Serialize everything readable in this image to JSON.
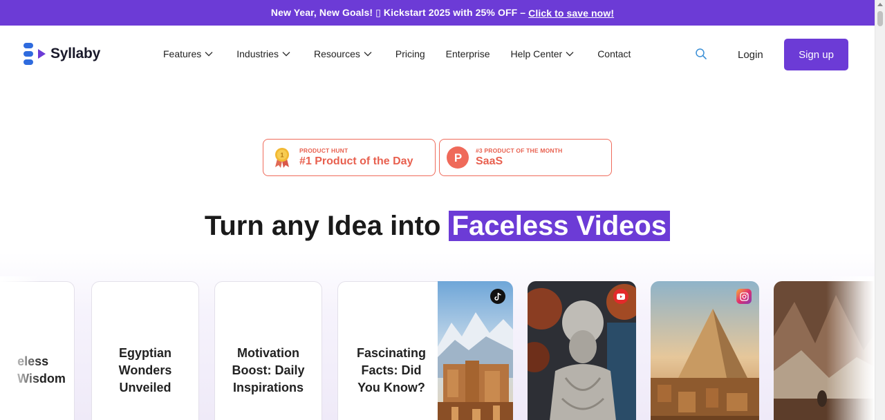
{
  "promo": {
    "text": "New Year, New Goals! ▯ Kickstart 2025 with 25% OFF –",
    "link": "Click to save now!"
  },
  "logo": {
    "text": "Syllaby"
  },
  "nav": {
    "items": [
      {
        "label": "Features",
        "dropdown": true
      },
      {
        "label": "Industries",
        "dropdown": true
      },
      {
        "label": "Resources",
        "dropdown": true
      },
      {
        "label": "Pricing",
        "dropdown": false
      },
      {
        "label": "Enterprise",
        "dropdown": false
      },
      {
        "label": "Help Center",
        "dropdown": true
      },
      {
        "label": "Contact",
        "dropdown": false
      }
    ],
    "search_icon": "search-icon",
    "login": "Login",
    "signup": "Sign up"
  },
  "badges": [
    {
      "kicker": "PRODUCT HUNT",
      "title": "#1 Product of the Day",
      "icon": "medal-icon",
      "medal_number": "1"
    },
    {
      "kicker": "#3 PRODUCT OF THE MONTH",
      "title": "SaaS",
      "icon": "product-hunt-icon",
      "letter": "P"
    }
  ],
  "hero": {
    "title_plain": "Turn any Idea into",
    "title_highlight": "Faceless Videos"
  },
  "gallery": {
    "text_cards": [
      {
        "lines": [
          "eless",
          "Wisdom"
        ]
      },
      {
        "lines": [
          "Egyptian",
          "Wonders",
          "Unveiled"
        ]
      },
      {
        "lines": [
          "Motivation",
          "Boost: Daily",
          "Inspirations"
        ]
      },
      {
        "lines": [
          "Fascinating",
          "Facts: Did",
          "You Know?"
        ]
      }
    ],
    "image_cards": [
      {
        "subject": "ancient-city-painting",
        "platform": "tiktok-icon"
      },
      {
        "subject": "philosopher-statue",
        "platform": "youtube-icon"
      },
      {
        "subject": "pyramid-landscape",
        "platform": "instagram-icon"
      },
      {
        "subject": "mountain-traveler",
        "platform": ""
      }
    ]
  },
  "colors": {
    "brand": "#6c3bd6",
    "badge": "#e8604f",
    "logo_blue": "#2f6bde"
  }
}
